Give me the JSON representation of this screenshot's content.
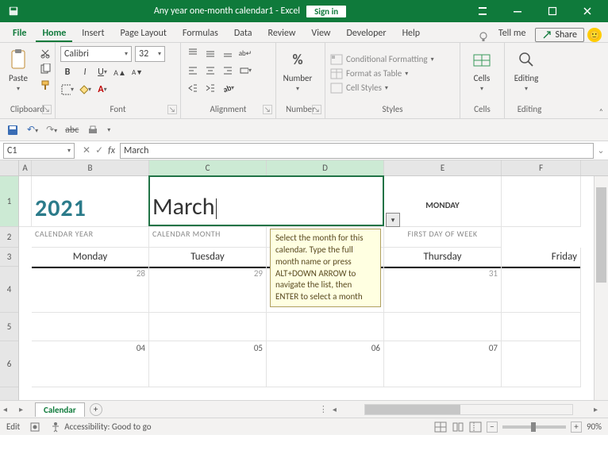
{
  "title": "Any year one-month calendar1  -  Excel",
  "signin": "Sign in",
  "tabs": [
    "File",
    "Home",
    "Insert",
    "Page Layout",
    "Formulas",
    "Data",
    "Review",
    "View",
    "Developer",
    "Help"
  ],
  "tellme": "Tell me",
  "share": "Share",
  "groups": {
    "clipboard": "Clipboard",
    "font": "Font",
    "alignment": "Alignment",
    "number": "Number",
    "styles": "Styles",
    "cells": "Cells",
    "editing": "Editing"
  },
  "paste_label": "Paste",
  "number_label": "Number",
  "cells_label": "Cells",
  "editing_label": "Editing",
  "cond_fmt": "Conditional Formatting",
  "fmt_table": "Format as Table",
  "cell_styles": "Cell Styles",
  "font_name": "Calibri",
  "font_size": "32",
  "cell_ref": "C1",
  "formula_value": "March",
  "year": "2021",
  "year_label": "CALENDAR YEAR",
  "month": "March",
  "month_label": "CALENDAR MONTH",
  "firstday": "MONDAY",
  "firstday_label": "FIRST DAY OF WEEK",
  "days": [
    "Monday",
    "Tuesday",
    "Thursday",
    "Friday"
  ],
  "row4": {
    "b": "28",
    "c": "29",
    "e": "31"
  },
  "row6": {
    "b": "04",
    "c": "05",
    "d": "06",
    "e": "07"
  },
  "tooltip_text": "Select the month for this calendar. Type the full month name or press ALT+DOWN ARROW to navigate the list, then ENTER to select a month",
  "sheet_tab": "Calendar",
  "status_mode": "Edit",
  "accessibility": "Accessibility: Good to go",
  "zoom": "90%",
  "col_letters": [
    "A",
    "B",
    "C",
    "D",
    "E",
    "F"
  ],
  "row_nums": [
    "1",
    "2",
    "3",
    "4",
    "5",
    "6"
  ]
}
